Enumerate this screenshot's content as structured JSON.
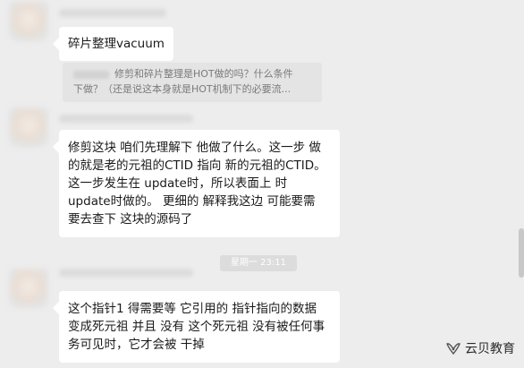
{
  "messages": [
    {
      "text_lines": [
        "碎片整理vacuum"
      ]
    },
    {
      "quote_lines": [
        "修剪和碎片整理是HOT做的吗？什么条件",
        "下做？（还是说这本身就是HOT机制下的必要流..."
      ]
    },
    {
      "text_lines": [
        "修剪这块 咱们先理解下 他做了什么。这一步 做",
        "的就是老的元祖的CTID 指向 新的元祖的CTID。",
        "这一步发生在 update时，所以表面上 时",
        "update时做的。  更细的 解释我这边 可能要需",
        "要去查下 这块的源码了"
      ]
    },
    {
      "text_lines": [
        "这个指针1 得需要等 它引用的 指针指向的数据",
        "变成死元祖 并且 没有 这个死元祖 没有被任何事",
        "务可见时，它才会被 干掉"
      ]
    }
  ],
  "timestamp": "星期一 23:11",
  "watermark": {
    "label": "云贝教育",
    "icon": "wechat-channel-icon"
  },
  "colors": {
    "background": "#ededed",
    "bubble": "#ffffff",
    "quote": "#e4e4e4"
  }
}
